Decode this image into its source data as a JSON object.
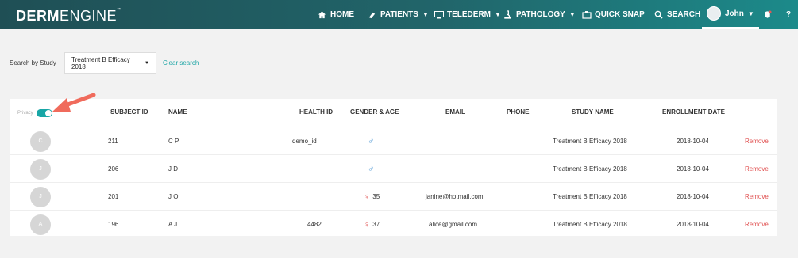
{
  "navbar": {
    "logo_bold": "DERM",
    "logo_light": "ENGINE",
    "logo_tm": "™",
    "home": "HOME",
    "patients": "PATIENTS",
    "telederm": "TELEDERM",
    "pathology": "PATHOLOGY",
    "quick_snap": "QUICK SNAP",
    "search": "SEARCH",
    "user": "John",
    "help": "?"
  },
  "filter": {
    "label": "Search by Study",
    "selected_study": "Treatment B Efficacy 2018",
    "clear_label": "Clear search"
  },
  "table": {
    "privacy_label": "Privacy",
    "privacy_on": true,
    "headers": {
      "subject_id": "SUBJECT ID",
      "name": "NAME",
      "health_id": "HEALTH ID",
      "gender_age": "GENDER & AGE",
      "email": "EMAIL",
      "phone": "PHONE",
      "study_name": "STUDY NAME",
      "enrollment_date": "ENROLLMENT DATE"
    },
    "rows": [
      {
        "initial": "C",
        "subject_id": "211",
        "name": "C P",
        "health_id": "demo_id",
        "gender": "male",
        "age": "",
        "email": "",
        "phone": "",
        "study": "Treatment B Efficacy 2018",
        "date": "2018-10-04",
        "action": "Remove"
      },
      {
        "initial": "J",
        "subject_id": "206",
        "name": "J D",
        "health_id": "",
        "gender": "male",
        "age": "",
        "email": "",
        "phone": "",
        "study": "Treatment B Efficacy 2018",
        "date": "2018-10-04",
        "action": "Remove"
      },
      {
        "initial": "J",
        "subject_id": "201",
        "name": "J O",
        "health_id": "",
        "gender": "female",
        "age": "35",
        "email": "janine@hotmail.com",
        "phone": "",
        "study": "Treatment B Efficacy 2018",
        "date": "2018-10-04",
        "action": "Remove"
      },
      {
        "initial": "A",
        "subject_id": "196",
        "name": "A J",
        "health_id": "4482",
        "gender": "female",
        "age": "37",
        "email": "alice@gmail.com",
        "phone": "",
        "study": "Treatment B Efficacy 2018",
        "date": "2018-10-04",
        "action": "Remove"
      }
    ]
  },
  "colors": {
    "accent": "#1ca5a5",
    "remove": "#e05050",
    "male": "#3f8fd0",
    "female": "#e25656",
    "annotation_arrow": "#f06b5c"
  }
}
